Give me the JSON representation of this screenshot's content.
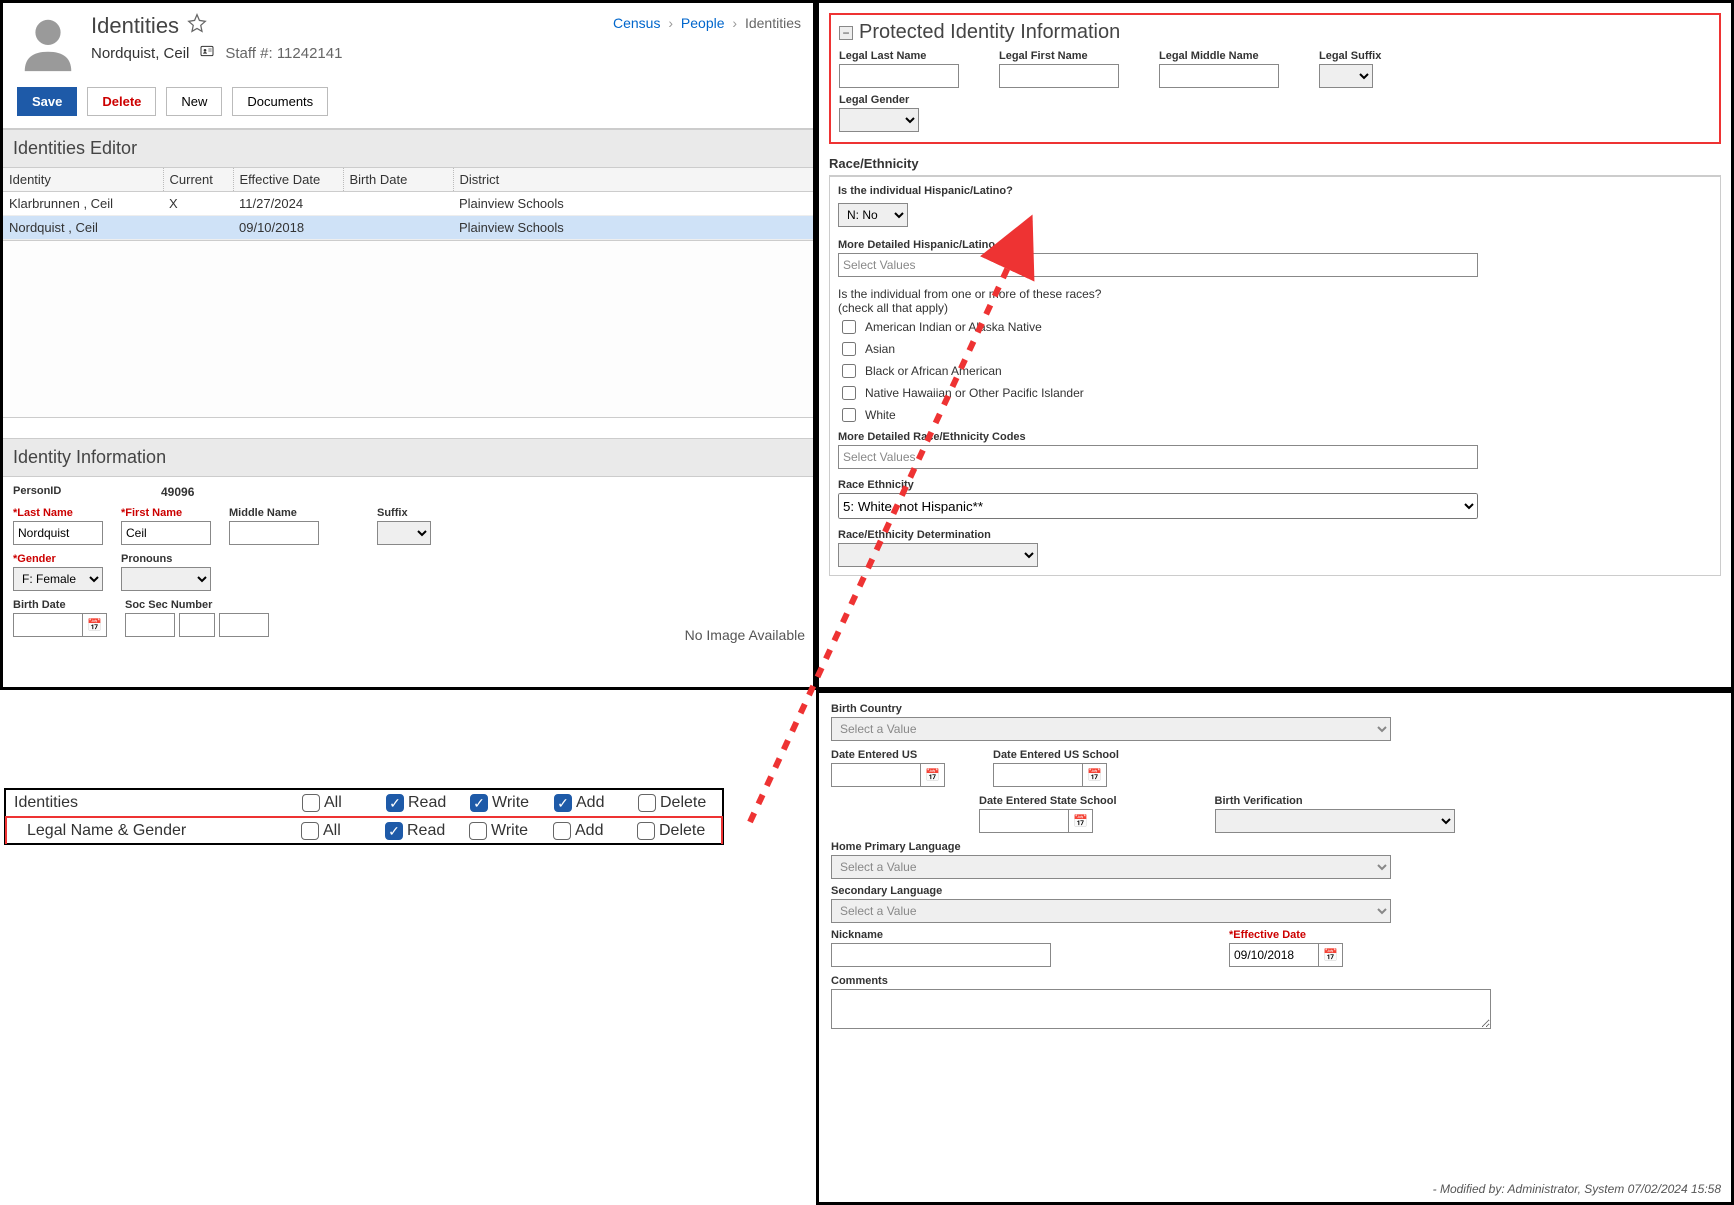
{
  "header": {
    "title": "Identities",
    "person_name": "Nordquist, Ceil",
    "staff_label": "Staff #:",
    "staff_no": "11242141"
  },
  "breadcrumb": {
    "a": "Census",
    "b": "People",
    "c": "Identities"
  },
  "toolbar": {
    "save": "Save",
    "delete": "Delete",
    "new": "New",
    "docs": "Documents"
  },
  "editor": {
    "title": "Identities Editor",
    "cols": {
      "identity": "Identity",
      "current": "Current",
      "eff": "Effective Date",
      "birth": "Birth Date",
      "district": "District"
    },
    "rows": [
      {
        "identity": "Klarbrunnen , Ceil",
        "current": "X",
        "eff": "11/27/2024",
        "birth": "",
        "district": "Plainview Schools"
      },
      {
        "identity": "Nordquist , Ceil",
        "current": "",
        "eff": "09/10/2018",
        "birth": "",
        "district": "Plainview Schools"
      }
    ]
  },
  "idinfo": {
    "title": "Identity Information",
    "personid_lbl": "PersonID",
    "personid": "49096",
    "last_lbl": "*Last Name",
    "last": "Nordquist",
    "first_lbl": "*First Name",
    "first": "Ceil",
    "middle_lbl": "Middle Name",
    "middle": "",
    "suffix_lbl": "Suffix",
    "gender_lbl": "*Gender",
    "gender": "F: Female",
    "pronouns_lbl": "Pronouns",
    "birth_lbl": "Birth Date",
    "ssn_lbl": "Soc Sec Number",
    "noimg": "No Image Available"
  },
  "pii": {
    "title": "Protected Identity Information",
    "llast": "Legal Last Name",
    "lfirst": "Legal First Name",
    "lmid": "Legal Middle Name",
    "lsfx": "Legal Suffix",
    "lgender": "Legal Gender"
  },
  "race": {
    "title": "Race/Ethnicity",
    "hisp_q": "Is the individual Hispanic/Latino?",
    "hisp_v": "N: No",
    "more_hisp": "More Detailed Hispanic/Latino Codes",
    "sel_ph": "Select Values",
    "races_q1": "Is the individual from one or more of these races?",
    "races_q2": "(check all that apply)",
    "r1": "American Indian or Alaska Native",
    "r2": "Asian",
    "r3": "Black or African American",
    "r4": "Native Hawaiian or Other Pacific Islander",
    "r5": "White",
    "more_race": "More Detailed Race/Ethnicity Codes",
    "re_lbl": "Race Ethnicity",
    "re_val": "5: White, not Hispanic**",
    "red_lbl": "Race/Ethnicity Determination"
  },
  "lower": {
    "bc_lbl": "Birth Country",
    "sel_val_ph": "Select a Value",
    "deus": "Date Entered US",
    "deuss": "Date Entered US School",
    "dess": "Date Entered State School",
    "bv": "Birth Verification",
    "hpl": "Home Primary Language",
    "sl": "Secondary Language",
    "nick": "Nickname",
    "eff_lbl": "*Effective Date",
    "eff_val": "09/10/2018",
    "comments": "Comments",
    "mod": " - Modified by: Administrator, System 07/02/2024 15:58"
  },
  "perm": {
    "row1": "Identities",
    "row2": "Legal Name & Gender",
    "all": "All",
    "read": "Read",
    "write": "Write",
    "add": "Add",
    "del": "Delete",
    "r1": {
      "all": false,
      "read": true,
      "write": true,
      "add": true,
      "del": false
    },
    "r2": {
      "all": false,
      "read": true,
      "write": false,
      "add": false,
      "del": false
    }
  }
}
